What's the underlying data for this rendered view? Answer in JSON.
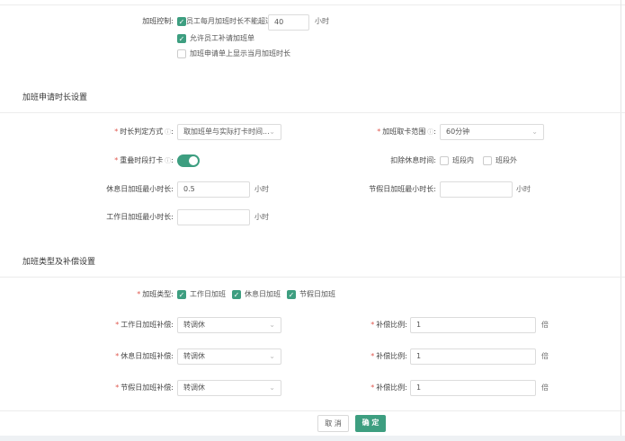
{
  "control": {
    "label": "加班控制:",
    "limit_text": "员工每月加班时长不能超过",
    "limit_value": "40",
    "unit": "小时",
    "allow_supplement": "允许员工补请加班单",
    "show_month_hours": "加班申请单上显示当月加班时长"
  },
  "duration": {
    "title": "加班申请时长设置",
    "method_label": "时长判定方式",
    "method_value": "取加班单与实际打卡时间...",
    "range_label": "加班取卡范围",
    "range_value": "60分钟",
    "overlap_label": "重叠时段打卡",
    "overlap_on": true,
    "deduct_label": "扣除休息时间:",
    "deduct_in": "班段内",
    "deduct_out": "班段外",
    "rest_min_label": "休息日加班最小时长:",
    "rest_min_value": "0.5",
    "holiday_min_label": "节假日加班最小时长:",
    "holiday_min_value": "",
    "work_min_label": "工作日加班最小时长:",
    "work_min_value": "",
    "unit": "小时",
    "colon": ":",
    "help": "?"
  },
  "types": {
    "title": "加班类型及补偿设置",
    "type_label": "加班类型:",
    "options": [
      "工作日加班",
      "休息日加班",
      "节假日加班"
    ],
    "rows": [
      {
        "label": "工作日加班补偿:",
        "value": "转调休",
        "ratio_label": "补偿比例:",
        "ratio": "1"
      },
      {
        "label": "休息日加班补偿:",
        "value": "转调休",
        "ratio_label": "补偿比例:",
        "ratio": "1"
      },
      {
        "label": "节假日加班补偿:",
        "value": "转调休",
        "ratio_label": "补偿比例:",
        "ratio": "1"
      }
    ],
    "ratio_unit": "倍"
  },
  "footer": {
    "cancel": "取 消",
    "ok": "确 定"
  },
  "colors": {
    "accent": "#3d9e80",
    "required": "#e0584f"
  }
}
